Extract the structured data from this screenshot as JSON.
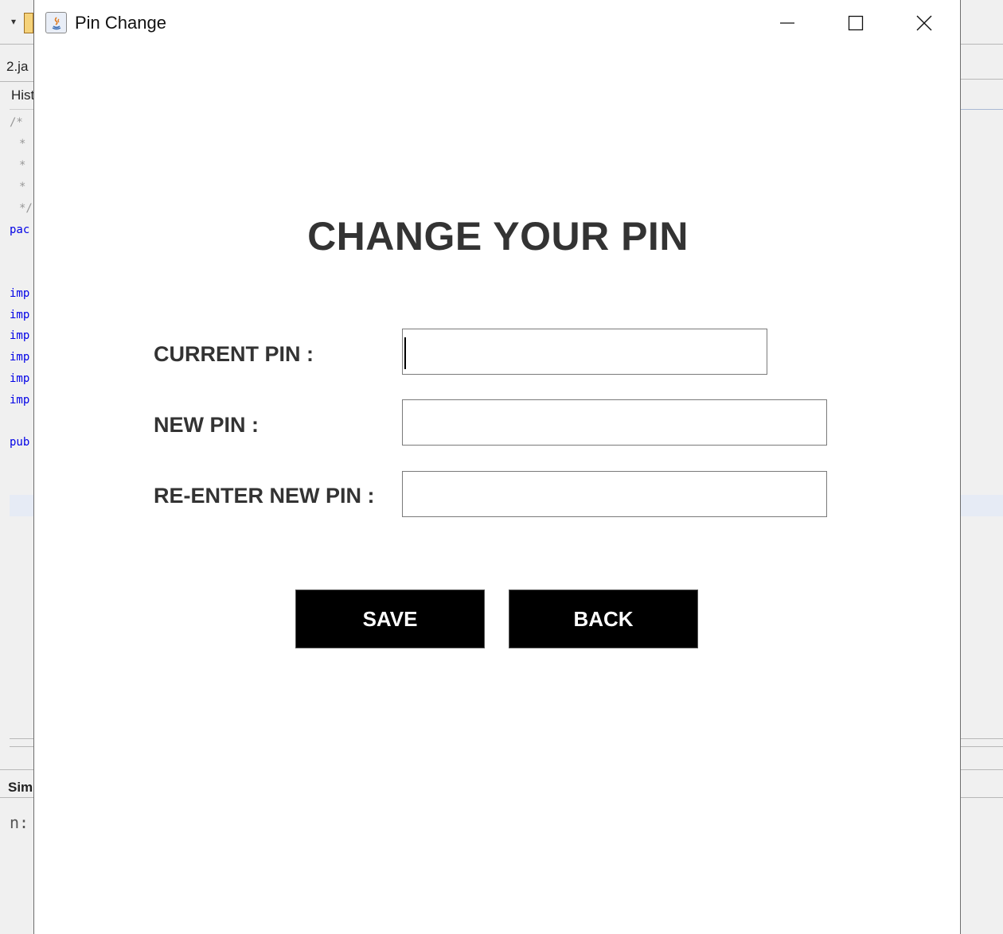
{
  "window": {
    "title": "Pin Change"
  },
  "form": {
    "heading": "CHANGE YOUR PIN",
    "current_pin_label": "CURRENT PIN :",
    "new_pin_label": "NEW PIN :",
    "reenter_pin_label": "RE-ENTER NEW PIN :",
    "current_pin_value": "",
    "new_pin_value": "",
    "reenter_pin_value": ""
  },
  "buttons": {
    "save_label": "SAVE",
    "back_label": "BACK"
  },
  "background_ide": {
    "tab_fragment": "2.ja",
    "menu_fragment": "Hist",
    "code_fragments": [
      "/*",
      "*",
      "*",
      "*",
      "*/",
      "pac",
      "imp",
      "imp",
      "imp",
      "imp",
      "imp",
      "imp",
      "pub"
    ],
    "panel_fragment": "Sim",
    "output_fragment": "n:"
  },
  "colors": {
    "button_bg": "#000000",
    "button_text": "#ffffff",
    "text": "#333333"
  }
}
